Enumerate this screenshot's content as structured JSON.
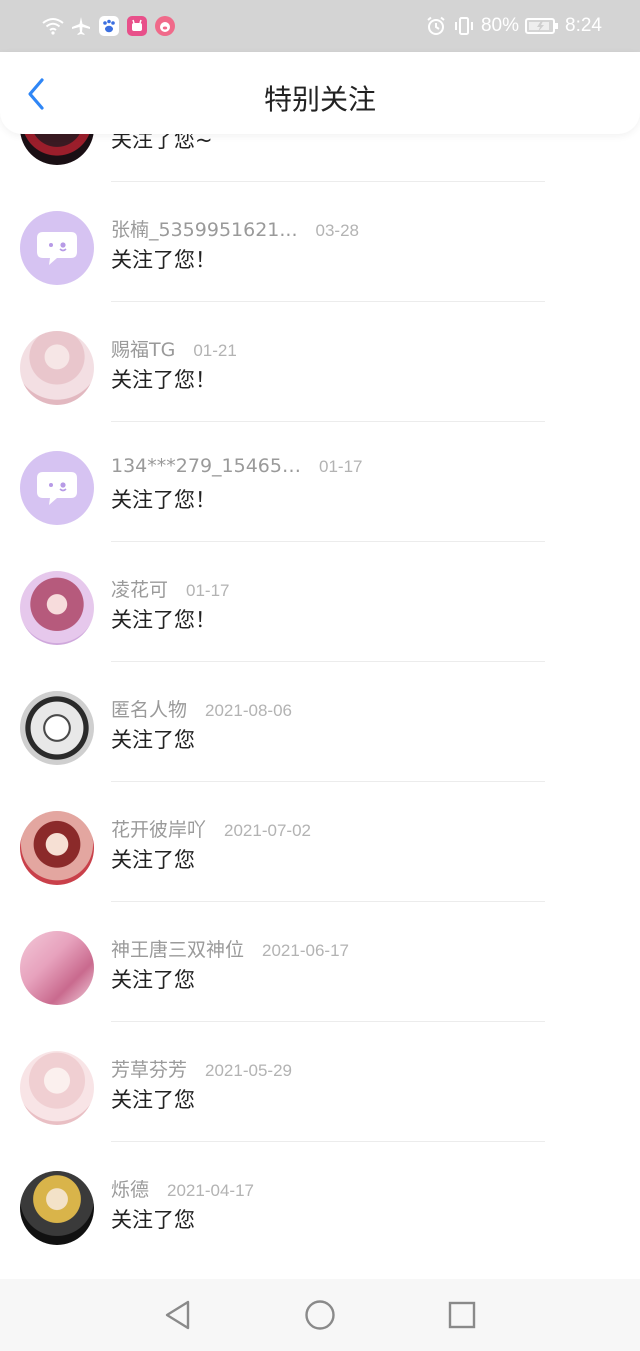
{
  "status_bar": {
    "battery_text": "80%",
    "time": "8:24",
    "icons": [
      "wifi-icon",
      "airplane-icon",
      "paw-app-icon",
      "pink-app-icon",
      "pig-app-icon",
      "alarm-icon",
      "vibrate-icon",
      "battery-icon"
    ]
  },
  "header": {
    "title": "特别关注",
    "back_icon": "chevron-left-icon",
    "accent_color": "#2f86f6"
  },
  "list": {
    "items": [
      {
        "name": "",
        "date": "",
        "message": "关注了您~",
        "avatar": "dark-anime-avatar"
      },
      {
        "name": "张楠_5359951621...",
        "date": "03-28",
        "message": "关注了您！",
        "avatar": "chat-bubble-avatar"
      },
      {
        "name": "赐福TG",
        "date": "01-21",
        "message": "关注了您！",
        "avatar": "pink-anime-avatar"
      },
      {
        "name": "134***279_154659...",
        "date": "01-17",
        "message": "关注了您！",
        "avatar": "chat-bubble-avatar"
      },
      {
        "name": "凌花可",
        "date": "01-17",
        "message": "关注了您！",
        "avatar": "purple-anime-avatar"
      },
      {
        "name": "匿名人物",
        "date": "2021-08-06",
        "message": "关注了您",
        "avatar": "sketch-anime-avatar"
      },
      {
        "name": "花开彼岸吖",
        "date": "2021-07-02",
        "message": "关注了您",
        "avatar": "red-anime-avatar"
      },
      {
        "name": "神王唐三双神位",
        "date": "2021-06-17",
        "message": "关注了您",
        "avatar": "pink-wing-avatar"
      },
      {
        "name": "芳草芬芳",
        "date": "2021-05-29",
        "message": "关注了您",
        "avatar": "pale-anime-avatar"
      },
      {
        "name": "烁德",
        "date": "2021-04-17",
        "message": "关注了您",
        "avatar": "blonde-anime-avatar"
      }
    ]
  },
  "nav_bar": {
    "buttons": [
      "back-triangle-icon",
      "home-circle-icon",
      "recents-square-icon"
    ]
  }
}
